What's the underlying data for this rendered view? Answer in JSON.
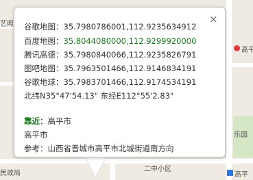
{
  "map": {
    "labels": {
      "top_left": "艺照",
      "right_top": "高平",
      "right_mid": "乐园",
      "bottom_left": "民政局",
      "bottom_mid": "二中小区",
      "bottom_right": "高平"
    }
  },
  "popup": {
    "close_icon_glyph": "×",
    "rows": [
      {
        "label": "谷歌地图：",
        "value": "35.7980786001,112.9235634912"
      },
      {
        "label": "百度地图：",
        "value": "35.8044080000,112.9299920000"
      },
      {
        "label": "腾讯高德：",
        "value": "35.7980840066,112.9235826791"
      },
      {
        "label": "图吧地图：",
        "value": "35.7963501466,112.9146834191"
      },
      {
        "label": "谷歌地球：",
        "value": "35.7983701466,112.9174534191"
      }
    ],
    "dms": "北纬N35°47'54.13\" 东经E112°55'2.83\"",
    "near_label": "靠近",
    "near_value": "：高平市",
    "city": "高平市",
    "reference": "参考：山西省晋城市高平市北城街道南方向"
  },
  "colors": {
    "baidu_highlight": "#1b7a1b",
    "near_label": "#1b7a1b"
  }
}
